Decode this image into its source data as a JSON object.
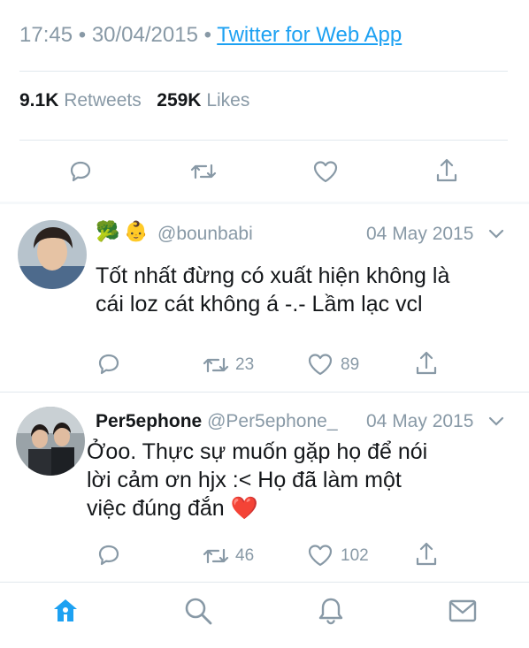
{
  "tweet": {
    "time": "17:45",
    "date": "30/04/2015",
    "separator": "•",
    "source": "Twitter for Web App",
    "retweets_count": "9.1K",
    "retweets_label": "Retweets",
    "likes_count": "259K",
    "likes_label": "Likes"
  },
  "replies": [
    {
      "name": "",
      "handle": "@bounbabi",
      "date": "04 May 2015",
      "text_line1": "Tốt nhất đừng có xuất hiện không là",
      "text_line2": "cái loz cát không á -.- Lầm lạc vcl",
      "retweets": "23",
      "likes": "89"
    },
    {
      "name": "Per5ephone",
      "handle": "@Per5ephone_",
      "date": "04 May 2015",
      "text_line1": "Ởoo. Thực sự muốn gặp họ để nói",
      "text_line2": "lời cảm ơn hjx :< Họ đã làm một",
      "text_line3": "việc đúng đắn",
      "text_emoji": "❤️",
      "retweets": "46",
      "likes": "102"
    }
  ],
  "colors": {
    "accent": "#1da1f2",
    "muted": "#8899a6",
    "text": "#14171a",
    "divider": "#e1e8ed"
  }
}
